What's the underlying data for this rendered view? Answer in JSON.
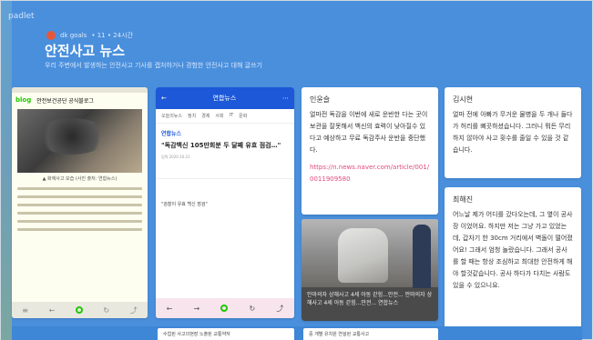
{
  "brand": "padlet",
  "author": {
    "name": "dk goals",
    "meta": "• 11 • 24시간"
  },
  "title": "안전사고 뉴스",
  "subtitle": "우리 주변에서 발생하는 안전사고 기사를 캡처하거나 경험한 안전사고 대해 글쓰기",
  "phone1": {
    "logo": "blog",
    "header": "안전보건공단 공식블로그",
    "caption": "▲ 화재사고 모습 (사진 출처: 연합뉴스)",
    "nav_icons": [
      "menu-icon",
      "back-icon",
      "home-icon",
      "reload-icon",
      "share-icon"
    ]
  },
  "phone2": {
    "app_title": "연합뉴스",
    "tabs": [
      "오늘의뉴스",
      "정치",
      "경제",
      "사회",
      "IT",
      "문화"
    ],
    "source": "연합뉴스",
    "headline": "\"독감백신 105만회분 두 달째 유효 점검…\"",
    "meta": "입력 2020.10.21",
    "highlight": "\"검찰이 유효 백신 점검\"",
    "nav_icons": [
      "back-icon",
      "forward-icon",
      "home-icon",
      "reload-icon",
      "share-icon"
    ]
  },
  "cards": {
    "inwonsul": {
      "author": "인윤슬",
      "body": "얼마전 독감을 이번에 새로 운반한 다는 곳이 보관을 잘못해서 백신의 효력이 낮아질수 있다고 예상하고 무료 독감주사 운반을 중단했다.",
      "link": "https://n.news.naver.com/article/001/0011909580"
    },
    "photo": {
      "caption": "안마의자 상해사고 4세 아동 갇힘...안전... 안마의자 상해사고 4세 아동 갇힘...안전... 연합뉴스"
    },
    "kimsihyun": {
      "author": "김시현",
      "body": "얼마 전에 아빠가 무거운 물병을 두 개나 들다가 허리를 삐끗하셨습니다. 그러니 뭐든 무리하지 않아야 사고 횟수를 줄일 수 있을 것 같습니다."
    },
    "choihejin": {
      "author": "최해진",
      "body": "어느날 제가 어디를 갔다오는데, 그 옆이 공사장 이었어요. 하지만 저는 그냥 가고 있었는데, 갑자기 한 30cm 거리에서 벽돌이 떨어졌어요! 그래서 엄청 놀랐습니다. 그래서 공사를 할 때는 항상 조심하고 최대한 안전하게 해야 할것같습니다. 공사 하다가 다치는 사람도 있을 수 있으니요."
    }
  },
  "bottom_cards": [
    "수업된 사고의현장 노출된 교통약자",
    "중 개별 유치원 연설된 교통사고"
  ]
}
